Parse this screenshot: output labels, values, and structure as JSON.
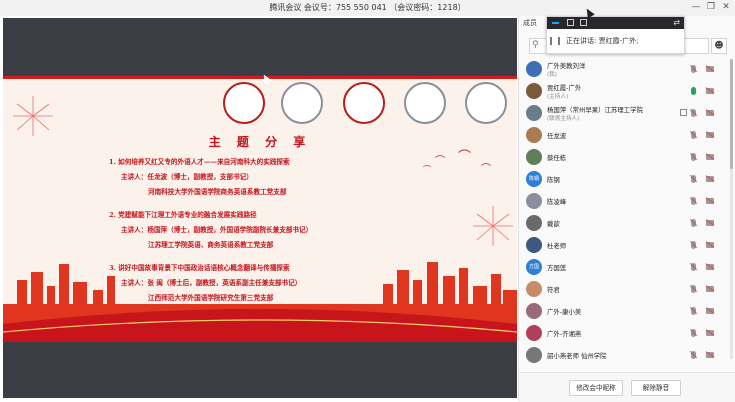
{
  "window": {
    "title": "腾讯会议 会议号：755 550 041 （会议密码：1218）",
    "controls": {
      "minimize": "—",
      "restore": "❐",
      "close": "✕"
    }
  },
  "members_panel": {
    "header": "成员",
    "speaking_prefix": "正在讲话:",
    "speaking_names": "贾红霞-广外;",
    "search_icon": "search-icon",
    "add_user_icon": "add-user-icon",
    "members": [
      {
        "name": "广外美教刘洋",
        "sub": "(我)",
        "avatar_color": "#3d6fb6",
        "avatar_text": "",
        "mic": "muted",
        "cam": "off",
        "share": false
      },
      {
        "name": "贾红霞-广外",
        "sub": "(主持人)",
        "avatar_color": "#7a5a3a",
        "avatar_text": "",
        "mic": "on",
        "cam": "off",
        "share": false
      },
      {
        "name": "杨国萍（常州早果）江苏理工学院",
        "sub": "(联席主持人)",
        "avatar_color": "#6b7c8d",
        "avatar_text": "",
        "mic": "muted",
        "cam": "off",
        "share": true
      },
      {
        "name": "任龙波",
        "sub": "",
        "avatar_color": "#a87b52",
        "avatar_text": "",
        "mic": "muted",
        "cam": "off",
        "share": false
      },
      {
        "name": "蔡任栋",
        "sub": "",
        "avatar_color": "#5f7f5a",
        "avatar_text": "",
        "mic": "muted",
        "cam": "off",
        "share": false
      },
      {
        "name": "陈钢",
        "sub": "",
        "avatar_color": "#2f7fd6",
        "avatar_text": "陈钢",
        "mic": "muted",
        "cam": "off",
        "share": false
      },
      {
        "name": "陈凌峰",
        "sub": "",
        "avatar_color": "#8a8f99",
        "avatar_text": "",
        "mic": "muted",
        "cam": "off",
        "share": false
      },
      {
        "name": "戴歆",
        "sub": "",
        "avatar_color": "#6a6a6a",
        "avatar_text": "",
        "mic": "muted",
        "cam": "off",
        "share": false
      },
      {
        "name": "杜老师",
        "sub": "",
        "avatar_color": "#3c5a80",
        "avatar_text": "",
        "mic": "muted",
        "cam": "off",
        "share": false
      },
      {
        "name": "方国莲",
        "sub": "",
        "avatar_color": "#2f7fd6",
        "avatar_text": "方国",
        "mic": "muted",
        "cam": "off",
        "share": false
      },
      {
        "name": "符君",
        "sub": "",
        "avatar_color": "#c98a6a",
        "avatar_text": "",
        "mic": "muted",
        "cam": "off",
        "share": false
      },
      {
        "name": "广外-康小美",
        "sub": "",
        "avatar_color": "#9a6a7a",
        "avatar_text": "",
        "mic": "muted",
        "cam": "off",
        "share": false
      },
      {
        "name": "广外-齐湘燕",
        "sub": "",
        "avatar_color": "#b0405a",
        "avatar_text": "",
        "mic": "muted",
        "cam": "off",
        "share": false
      },
      {
        "name": "韶小燕老师 仙州学院",
        "sub": "",
        "avatar_color": "#777777",
        "avatar_text": "",
        "mic": "muted",
        "cam": "off",
        "share": false
      }
    ],
    "buttons": {
      "rename": "修改会中昵称",
      "unmute_all": "解除静音"
    }
  },
  "slide": {
    "title": "主 题 分 享",
    "lines": [
      "1. 如何培养又红又专的外语人才——来自河南科大的实践探索",
      "主讲人：任龙波（博士，副教授，支部书记）",
      "河南科技大学外国语学院商务英语系教工党支部",
      "2. 党建赋能下江理工外语专业的融合发展实践路径",
      "主讲人：杨国萍（博士，副教授，外国语学院副院长兼支部书记）",
      "江苏理工学院英语、商务英语系教工党支部",
      "3. 讲好中国故事背景下中国政治话语核心概念翻译与传播探索",
      "主讲人：张 闽（博士后，副教授，英语系副主任兼支部书记）",
      "江西师范大学外国语学院研究生第三党支部"
    ],
    "logo_icons": [
      "university-seal-icon",
      "university-seal-icon",
      "university-seal-icon",
      "university-seal-icon",
      "university-seal-icon"
    ]
  }
}
